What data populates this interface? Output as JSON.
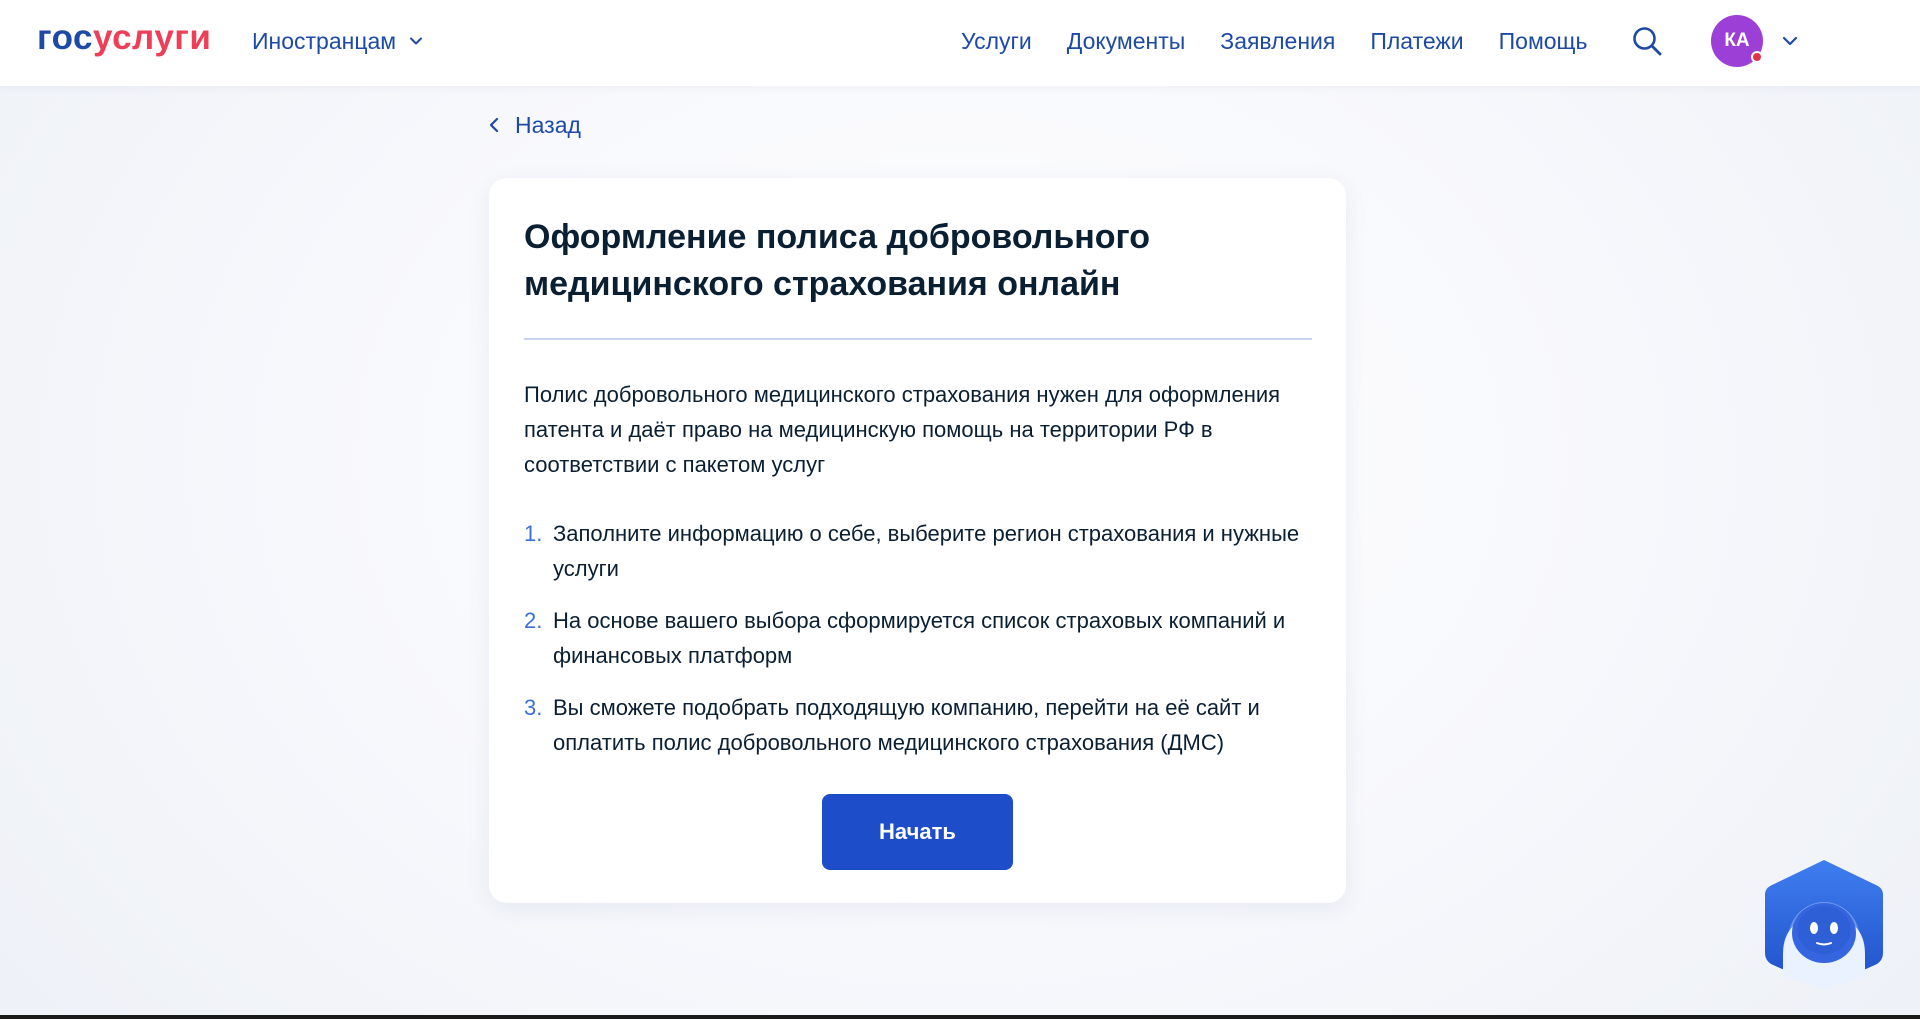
{
  "header": {
    "logo_part1": "гос",
    "logo_part2": "услуги",
    "lang_label": "Иностранцам",
    "nav": [
      "Услуги",
      "Документы",
      "Заявления",
      "Платежи",
      "Помощь"
    ],
    "avatar_initials": "КА"
  },
  "back_label": "Назад",
  "card": {
    "title": "Оформление полиса добровольного медицинского страхования онлайн",
    "intro": "Полис добровольного медицинского страхования нужен для оформления патента и даёт право на медицинскую помощь на территории РФ в соответствии с пакетом услуг",
    "steps": [
      {
        "num": "1.",
        "text": "Заполните информацию о себе, выберите регион страхования и нужные услуги"
      },
      {
        "num": "2.",
        "text": "На основе вашего выбора сформируется список страховых компаний и финансовых платформ"
      },
      {
        "num": "3.",
        "text": "Вы сможете подобрать подходящую компанию, перейти на её сайт и оплатить полис добровольного медицинского страхования (ДМС)"
      }
    ],
    "start_button": "Начать"
  },
  "colors": {
    "brand_blue": "#1d4aa7",
    "brand_red": "#ee3f58",
    "button_blue": "#1d4dc9",
    "avatar_purple": "#9c3fd6"
  },
  "icons": [
    "chevron-down-icon",
    "search-icon",
    "chevron-left-icon",
    "assistant-robot-icon"
  ]
}
